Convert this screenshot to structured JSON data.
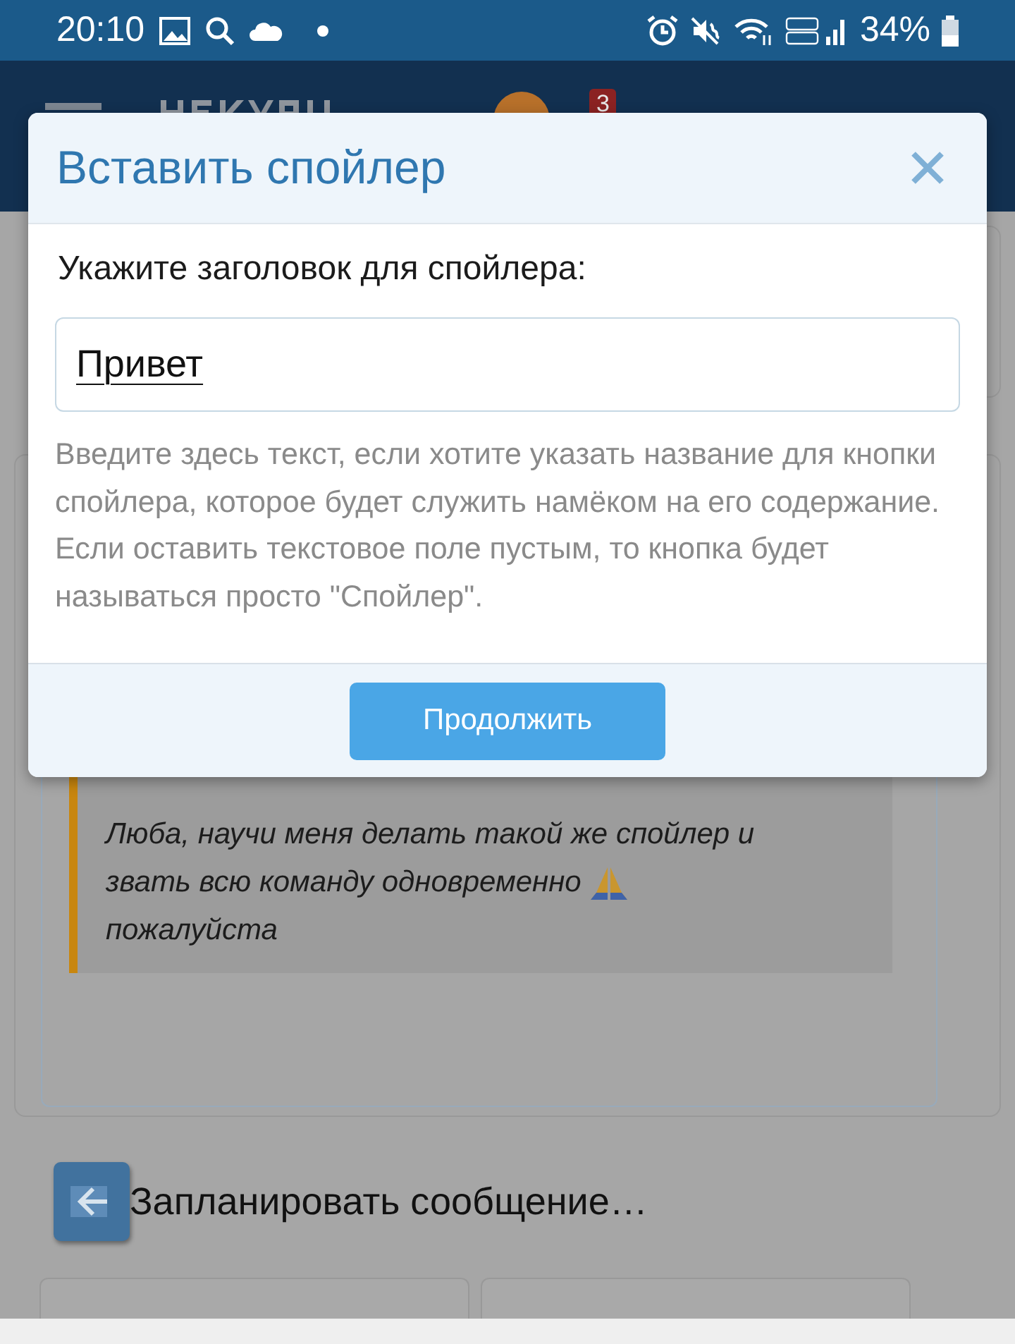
{
  "status_bar": {
    "time": "20:10",
    "battery": "34%"
  },
  "header": {
    "badge": "3"
  },
  "background": {
    "quote": [
      "Люба, научи меня делать такой же спойлер и",
      "звать всю команду одновременно",
      "пожалуйста"
    ],
    "schedule_label": "Запланировать сообщение…"
  },
  "dialog": {
    "title": "Вставить спойлер",
    "label": "Укажите заголовок для спойлера:",
    "input": {
      "value": "Привет"
    },
    "hint": "Введите здесь текст, если хотите указать название для кнопки спойлера, которое будет служить намёком на его содержание. Если оставить текстовое поле пустым, то кнопка будет называться просто \"Спойлер\".",
    "button": "Продолжить"
  }
}
